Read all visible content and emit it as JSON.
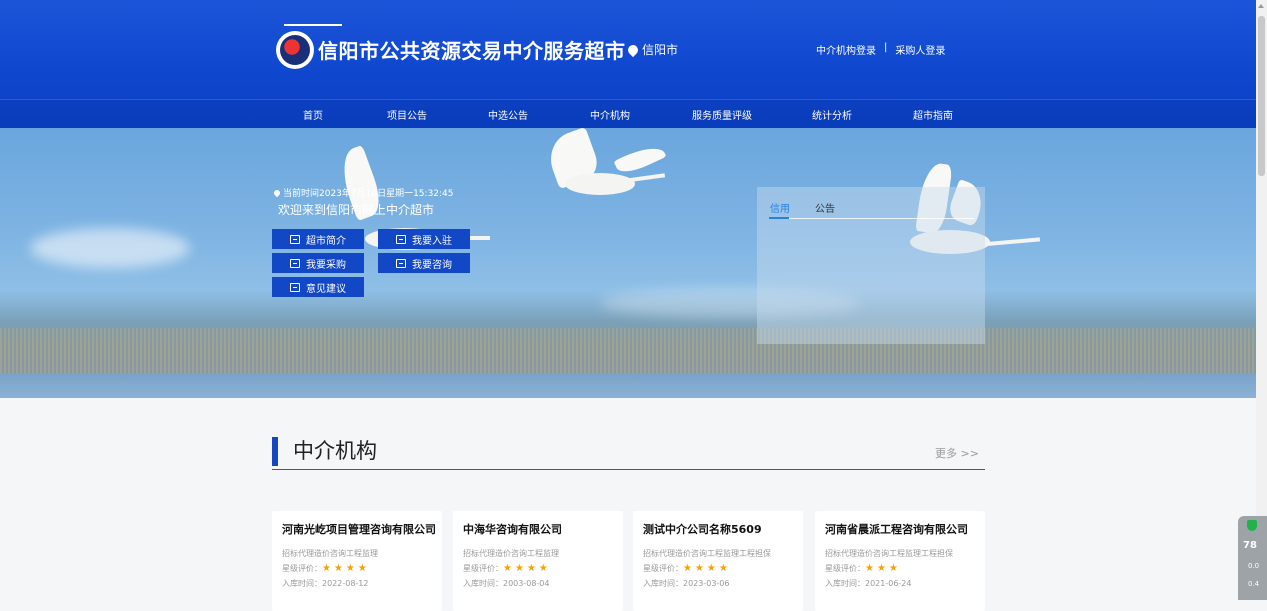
{
  "header": {
    "site_title": "信阳市公共资源交易中介服务超市",
    "city": "信阳市",
    "login_agency": "中介机构登录",
    "separator": "|",
    "login_purchaser": "采购人登录"
  },
  "nav": {
    "items": [
      "首页",
      "项目公告",
      "中选公告",
      "中介机构",
      "服务质量评级",
      "统计分析",
      "超市指南"
    ],
    "active_index": 0
  },
  "hero": {
    "time_text": "当前时间2023年7月10日星期一15:32:45",
    "welcome": "欢迎来到信阳市网上中介超市",
    "buttons": [
      {
        "label": "超市简介",
        "icon": "building-icon"
      },
      {
        "label": "我要入驻",
        "icon": "register-icon"
      },
      {
        "label": "我要采购",
        "icon": "cart-icon"
      },
      {
        "label": "我要咨询",
        "icon": "consult-icon"
      },
      {
        "label": "意见建议",
        "icon": "edit-icon"
      }
    ],
    "notice_tabs": [
      "信用",
      "公告"
    ],
    "notice_active": "信用"
  },
  "section": {
    "title": "中介机构",
    "more": "更多 >>"
  },
  "agencies": [
    {
      "name": "河南光屹项目管理咨询有限公司",
      "service": "招标代理造价咨询工程监理",
      "rating_label": "星级评价：",
      "stars": 4,
      "join_date": "入库时间：2022-08-12"
    },
    {
      "name": "中海华咨询有限公司",
      "service": "招标代理造价咨询工程监理",
      "rating_label": "星级评价：",
      "stars": 4,
      "join_date": "入库时间：2003-08-04"
    },
    {
      "name": "测试中介公司名称5609",
      "service": "招标代理造价咨询工程监理工程担保",
      "rating_label": "星级评价：",
      "stars": 4,
      "join_date": "入库时间：2023-03-06"
    },
    {
      "name": "河南省晨派工程咨询有限公司",
      "service": "招标代理造价咨询工程监理工程担保",
      "rating_label": "星级评价：",
      "stars": 3,
      "join_date": "入库时间：2021-06-24"
    }
  ],
  "widget": {
    "score": "78",
    "speed_up": "0.0",
    "speed_down": "0.4"
  },
  "colors": {
    "brand_blue": "#1447c0",
    "star": "#f5a300"
  }
}
